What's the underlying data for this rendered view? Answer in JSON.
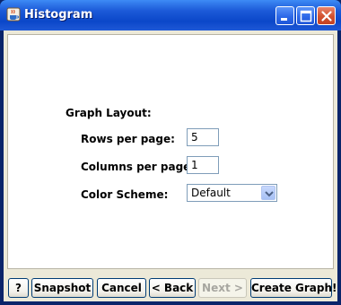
{
  "window": {
    "title": "Histogram",
    "title_icon": "java-cup-icon",
    "controls": [
      "minimize-icon",
      "maximize-icon",
      "close-icon"
    ]
  },
  "form": {
    "section_label": "Graph Layout:",
    "rows_label": "Rows per page:",
    "rows_value": "5",
    "columns_label": "Columns per page:",
    "columns_value": "1",
    "color_label": "Color Scheme:",
    "color_value": "Default"
  },
  "buttons": {
    "help": "?",
    "snapshot": "Snapshot",
    "cancel": "Cancel",
    "back": "< Back",
    "next": "Next >",
    "create": "Create Graph!"
  },
  "colors": {
    "titlebar": "#0b47c9",
    "panel": "#ece9d8",
    "close_button": "#d2512f"
  }
}
